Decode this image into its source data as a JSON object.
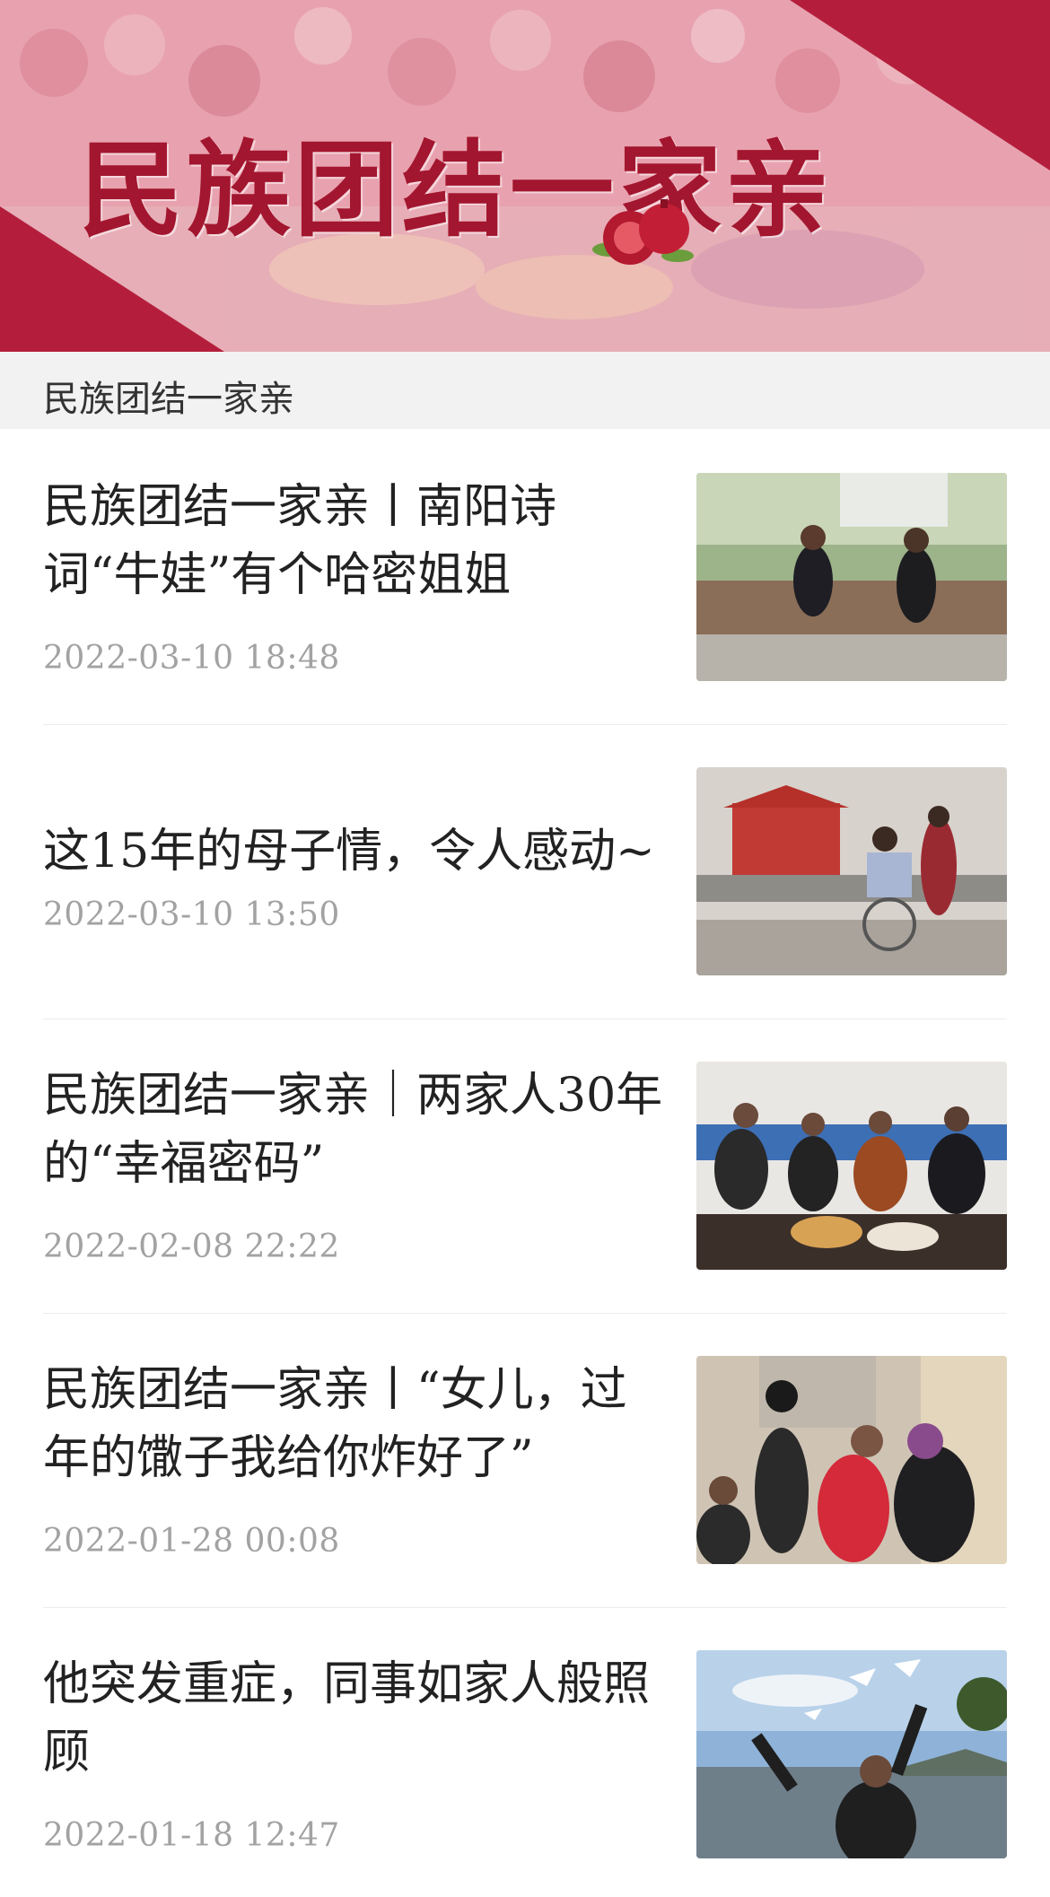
{
  "banner": {
    "title": "民族团结一家亲",
    "image_label": "banner-image"
  },
  "section": {
    "title": "民族团结一家亲"
  },
  "articles": [
    {
      "headline": "民族团结一家亲丨南阳诗词“牛娃”有个哈密姐姐",
      "date": "2022-03-10  18:48",
      "thumb_icon": "photo-thumbnail-icon"
    },
    {
      "headline": "这15年的母子情，令人感动~",
      "date": "2022-03-10  13:50",
      "thumb_icon": "photo-thumbnail-icon"
    },
    {
      "headline": "民族团结一家亲｜两家人30年的“幸福密码”",
      "date": "2022-02-08  22:22",
      "thumb_icon": "photo-thumbnail-icon"
    },
    {
      "headline": "民族团结一家亲丨“女儿，过年的馓子我给你炸好了”",
      "date": "2022-01-28  00:08",
      "thumb_icon": "photo-thumbnail-icon"
    },
    {
      "headline": "他突发重症，同事如家人般照顾",
      "date": "2022-01-18  12:47",
      "thumb_icon": "photo-thumbnail-icon"
    }
  ],
  "colors": {
    "banner_red": "#a3162f",
    "header_bg": "#f2f2f2",
    "date_gray": "#a2a2a2",
    "headline": "#222222"
  }
}
